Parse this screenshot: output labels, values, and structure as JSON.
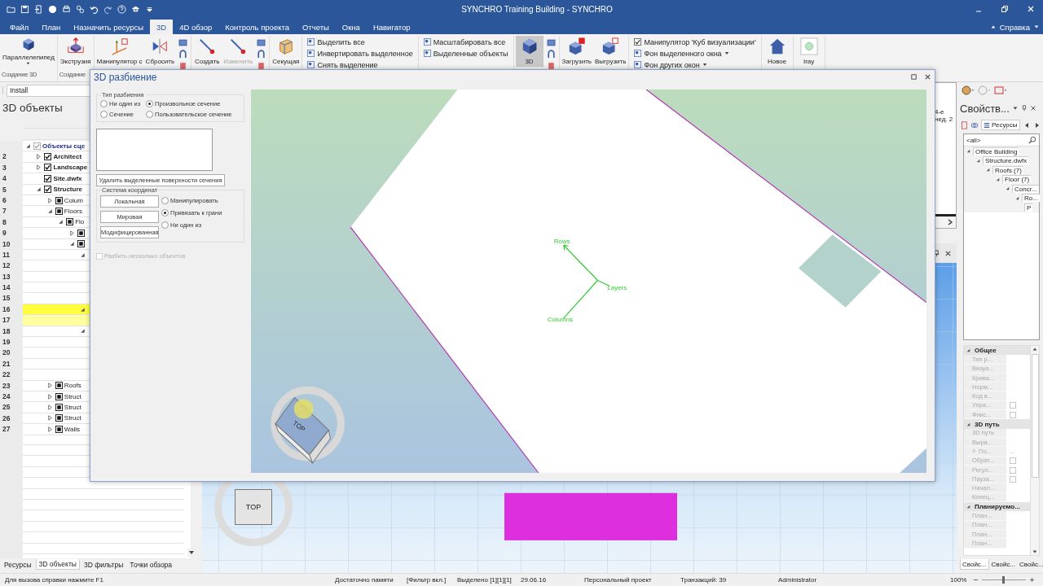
{
  "title_bar": {
    "title": "SYNCHRO Training Building - SYNCHRO"
  },
  "menu_tabs": [
    {
      "label": "Файл",
      "selected": false
    },
    {
      "label": "План",
      "selected": false
    },
    {
      "label": "Назначить ресурсы",
      "selected": false
    },
    {
      "label": "3D",
      "selected": true
    },
    {
      "label": "4D обзор",
      "selected": false
    },
    {
      "label": "Контроль проекта",
      "selected": false
    },
    {
      "label": "Отчеты",
      "selected": false
    },
    {
      "label": "Окна",
      "selected": false
    },
    {
      "label": "Навигатор",
      "selected": false
    }
  ],
  "help": {
    "label": "Справка"
  },
  "ribbon": {
    "groups": [
      {
        "label": "Создание 3D",
        "items": [
          {
            "kind": "big",
            "label": "Параллелепипед",
            "pressed": false,
            "disabled": false,
            "dropdown": true
          }
        ]
      },
      {
        "label": "Создание",
        "items": [
          {
            "kind": "big",
            "label": "Экструзия",
            "pressed": false,
            "disabled": false,
            "dropdown": false
          }
        ]
      },
      {
        "items": [
          {
            "kind": "big",
            "label": "Манипулятор с",
            "pressed": false,
            "disabled": false,
            "dropdown": false
          },
          {
            "kind": "big",
            "label": "Сбросить",
            "pressed": false,
            "disabled": false,
            "dropdown": false
          },
          {
            "kind": "icon_column"
          }
        ]
      },
      {
        "items": [
          {
            "kind": "big",
            "label": "Создать",
            "pressed": false,
            "disabled": false,
            "dropdown": false
          },
          {
            "kind": "big",
            "label": "Изменить",
            "pressed": false,
            "disabled": true,
            "dropdown": false
          },
          {
            "kind": "icon_column"
          }
        ]
      },
      {
        "items": [
          {
            "kind": "big",
            "label": "Секущая",
            "pressed": false,
            "disabled": false,
            "dropdown": false
          }
        ]
      },
      {
        "items": [
          {
            "kind": "list",
            "entries": [
              {
                "kind": "plain",
                "label": "Выделить все"
              },
              {
                "kind": "plain",
                "label": "Инвертировать выделенное"
              },
              {
                "kind": "plain",
                "label": "Снять выделение"
              }
            ]
          }
        ]
      },
      {
        "items": [
          {
            "kind": "list",
            "entries": [
              {
                "kind": "plain",
                "label": "Масштабировать все"
              },
              {
                "kind": "plain",
                "label": "Выделенные объекты"
              }
            ]
          }
        ]
      },
      {
        "items": [
          {
            "kind": "big",
            "label": "3D",
            "pressed": true,
            "disabled": false,
            "dropdown": false
          },
          {
            "kind": "icon_column"
          }
        ]
      },
      {
        "items": [
          {
            "kind": "big",
            "label": "Загрузить",
            "pressed": false,
            "disabled": false,
            "dropdown": false
          },
          {
            "kind": "big",
            "label": "Выгрузить",
            "pressed": false,
            "disabled": false,
            "dropdown": false
          }
        ]
      },
      {
        "items": [
          {
            "kind": "list",
            "entries": [
              {
                "kind": "check",
                "label": "Манипулятор 'Куб визуализации'",
                "checked": true
              },
              {
                "kind": "menu",
                "label": "Фон выделенного окна"
              },
              {
                "kind": "menu",
                "label": "Фон других окон"
              }
            ]
          }
        ]
      },
      {
        "items": [
          {
            "kind": "big",
            "label": "Новое",
            "pressed": false,
            "disabled": false,
            "dropdown": false
          }
        ]
      },
      {
        "items": [
          {
            "kind": "big",
            "label": "Iray",
            "pressed": false,
            "disabled": false,
            "dropdown": false
          }
        ]
      }
    ]
  },
  "left_panel": {
    "toolbar_field": {
      "value": "Install"
    },
    "title": "3D объекты",
    "tree": [
      {
        "label": "Объекты сце",
        "expanded": true,
        "checked": true,
        "partial": false,
        "children": [
          {
            "num": "2",
            "label": "Architect",
            "expanded": false,
            "checked": true,
            "partial": false
          },
          {
            "num": "3",
            "label": "Landscape",
            "expanded": false,
            "checked": true,
            "partial": false
          },
          {
            "num": "4",
            "label": "Site.dwfx",
            "checked": true,
            "partial": false
          },
          {
            "num": "5",
            "label": "Structure",
            "expanded": true,
            "checked": true,
            "partial": false,
            "children": [
              {
                "num": "6",
                "label": "Colum",
                "expanded": false,
                "checked": false,
                "partial": true
              },
              {
                "num": "7",
                "label": "Floors",
                "expanded": true,
                "checked": false,
                "partial": true,
                "children": [
                  {
                    "num": "8",
                    "label": "Flo",
                    "expanded": true,
                    "checked": false,
                    "partial": true,
                    "children": [
                      {
                        "num": "9",
                        "expanded": false,
                        "checked": false,
                        "partial": true
                      },
                      {
                        "num": "10",
                        "expanded": true,
                        "checked": false,
                        "partial": true,
                        "children": [
                          {
                            "num": "11",
                            "expanded": true,
                            "children": [
                              {
                                "num": "12"
                              },
                              {
                                "num": "13"
                              },
                              {
                                "num": "14"
                              },
                              {
                                "num": "15"
                              }
                            ]
                          },
                          {
                            "num": "16",
                            "expanded": true,
                            "color": "#ffff40",
                            "children": [
                              {
                                "num": "17",
                                "color": "#ffffa0"
                              }
                            ]
                          },
                          {
                            "num": "18",
                            "expanded": true,
                            "children": [
                              {
                                "num": "19"
                              },
                              {
                                "num": "20"
                              },
                              {
                                "num": "21"
                              }
                            ]
                          },
                          {
                            "num": "22"
                          }
                        ]
                      }
                    ]
                  }
                ]
              },
              {
                "num": "23",
                "label": "Roofs",
                "expanded": false,
                "checked": false,
                "partial": true
              },
              {
                "num": "24",
                "label": "Struct",
                "expanded": false,
                "checked": false,
                "partial": true
              },
              {
                "num": "25",
                "label": "Struct",
                "expanded": false,
                "checked": false,
                "partial": true
              },
              {
                "num": "26",
                "label": "Struct",
                "expanded": false,
                "checked": false,
                "partial": true
              },
              {
                "num": "27",
                "label": "Walls",
                "expanded": false,
                "checked": false,
                "partial": true
              }
            ]
          }
        ]
      }
    ],
    "tabs": [
      {
        "label": "Ресурсы",
        "selected": false
      },
      {
        "label": "3D объекты",
        "selected": true
      },
      {
        "label": "3D фильтры",
        "selected": false
      },
      {
        "label": "Точки обзора",
        "selected": false
      }
    ]
  },
  "center": {
    "gantt_header": [
      "4-е",
      "нед. 2"
    ],
    "view_cube": {
      "label": "TOP"
    }
  },
  "dialog": {
    "title": "3D разбиение",
    "split_type": {
      "label": "Тип разбиения",
      "options": [
        {
          "label": "Ни один из",
          "selected": false
        },
        {
          "label": "Произвольное сечение",
          "selected": true
        },
        {
          "label": "Сечение",
          "selected": false
        },
        {
          "label": "Пользовательское сечение",
          "selected": false
        }
      ]
    },
    "delete_button": "Удалить выделенные поверхности сечения",
    "coordinates": {
      "label": "Система координат",
      "buttons": [
        "Локальная",
        "Мировая",
        "Модифицированная"
      ],
      "options": [
        {
          "label": "Манипулировать",
          "selected": false
        },
        {
          "label": "Привязать к грани",
          "selected": true
        },
        {
          "label": "Ни один из",
          "selected": false
        }
      ]
    },
    "split_multiple": {
      "label": "Разбить несколько объектов",
      "checked": false,
      "disabled": true
    },
    "viewport": {
      "axes": [
        "Rows",
        "Layers",
        "Columns"
      ],
      "cube_label": "TOP"
    }
  },
  "right_panel": {
    "title": "Свойств...",
    "tab": {
      "label": "Ресурсы",
      "selected": true
    },
    "search": {
      "value": "<all>"
    },
    "tree": [
      {
        "label": "Office Building",
        "expanded": true,
        "children": [
          {
            "label": "Structure.dwfx",
            "expanded": true,
            "children": [
              {
                "label": "Roofs (7)",
                "expanded": true,
                "children": [
                  {
                    "label": "Floor (7)",
                    "expanded": true,
                    "children": [
                      {
                        "label": "Concr...",
                        "expanded": true,
                        "children": [
                          {
                            "label": "Ro...",
                            "expanded": true,
                            "children": [
                              {
                                "label": "P"
                              }
                            ]
                          }
                        ]
                      }
                    ]
                  }
                ]
              }
            ]
          }
        ]
      }
    ],
    "properties": [
      {
        "label": "Общее",
        "expanded": true,
        "rows": [
          {
            "kind": "text",
            "label": "Тип р..."
          },
          {
            "kind": "text",
            "label": "Визуа..."
          },
          {
            "kind": "text",
            "label": "Крива..."
          },
          {
            "kind": "text",
            "label": "Норм..."
          },
          {
            "kind": "text",
            "label": "Код в..."
          },
          {
            "kind": "check",
            "label": "Упра...",
            "checked": false
          },
          {
            "kind": "check",
            "label": "Фикс...",
            "checked": false
          }
        ]
      },
      {
        "label": "3D путь",
        "expanded": true,
        "rows": [
          {
            "kind": "text",
            "label": "3D путь"
          },
          {
            "kind": "text",
            "label": "Выра..."
          },
          {
            "kind": "expander",
            "label": "По...",
            "value": "..."
          },
          {
            "kind": "check",
            "label": "Обрат...",
            "checked": false
          },
          {
            "kind": "check",
            "label": "Регул...",
            "checked": false
          },
          {
            "kind": "check",
            "label": "Пауза...",
            "checked": false
          },
          {
            "kind": "text",
            "label": "Начал..."
          },
          {
            "kind": "text",
            "label": "Конец..."
          }
        ]
      },
      {
        "label": "Планируемо...",
        "expanded": true,
        "rows": [
          {
            "kind": "text",
            "label": "План..."
          },
          {
            "kind": "text",
            "label": "План..."
          },
          {
            "kind": "text",
            "label": "План..."
          },
          {
            "kind": "text",
            "label": "План..."
          }
        ]
      }
    ],
    "tabs": [
      {
        "label": "Свойс...",
        "selected": true
      },
      {
        "label": "Свойс...",
        "selected": false
      },
      {
        "label": "Свойс...",
        "selected": false
      }
    ]
  },
  "status_bar": {
    "items": [
      "Для вызова справки нажмите F1",
      "Достаточно памяти",
      "[Фильтр вкл.]",
      "Выделено [1][1][1]",
      "29.06.16",
      "Персональный проект",
      "Транзакций: 39",
      "Administrator"
    ],
    "zoom": {
      "label": "100%",
      "level": 0.48
    }
  }
}
